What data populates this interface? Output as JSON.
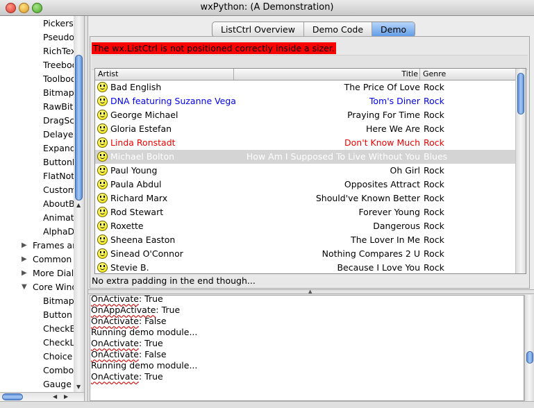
{
  "window": {
    "title": "wxPython: (A Demonstration)"
  },
  "tree": {
    "items": [
      {
        "label": "Pickers",
        "level": 2
      },
      {
        "label": "PseudoDC",
        "level": 2
      },
      {
        "label": "RichTextCtrl",
        "level": 2
      },
      {
        "label": "Treebook",
        "level": 2
      },
      {
        "label": "Toolbook",
        "level": 2
      },
      {
        "label": "BitmapButton",
        "level": 2
      },
      {
        "label": "RawBitmapAccess",
        "level": 2
      },
      {
        "label": "DragScroller",
        "level": 2
      },
      {
        "label": "DelayedResult",
        "level": 2
      },
      {
        "label": "ExpandoTextCtrl",
        "level": 2
      },
      {
        "label": "ButtonPanel",
        "level": 2
      },
      {
        "label": "FlatNotebook",
        "level": 2
      },
      {
        "label": "CustomTreeCtrl",
        "level": 2
      },
      {
        "label": "AboutBox",
        "level": 2
      },
      {
        "label": "AnimateCtrl",
        "level": 2
      },
      {
        "label": "AlphaDrawing",
        "level": 2
      },
      {
        "label": "Frames and Dialogs",
        "level": 1,
        "expanded": false
      },
      {
        "label": "Common Dialogs",
        "level": 1,
        "expanded": false
      },
      {
        "label": "More Dialogs",
        "level": 1,
        "expanded": false
      },
      {
        "label": "Core Windows/Controls",
        "level": 1,
        "expanded": true
      },
      {
        "label": "BitmapButton",
        "level": 2
      },
      {
        "label": "Button",
        "level": 2
      },
      {
        "label": "CheckBox",
        "level": 2
      },
      {
        "label": "CheckListBox",
        "level": 2
      },
      {
        "label": "Choice",
        "level": 2
      },
      {
        "label": "ComboBox",
        "level": 2
      },
      {
        "label": "Gauge",
        "level": 2
      }
    ]
  },
  "tabs": [
    {
      "label": "ListCtrl Overview",
      "selected": false
    },
    {
      "label": "Demo Code",
      "selected": false
    },
    {
      "label": "Demo",
      "selected": true
    }
  ],
  "demo": {
    "warning": "The wx.ListCtrl is not positioned correctly inside a sizer.",
    "columns": {
      "artist": "Artist",
      "title": "Title",
      "genre": "Genre"
    },
    "rows": [
      {
        "artist": "Bad English",
        "title": "The Price Of Love",
        "genre": "Rock",
        "color": "#000000",
        "selected": false
      },
      {
        "artist": "DNA featuring Suzanne Vega",
        "title": "Tom's Diner",
        "genre": "Rock",
        "color": "#0000ee",
        "selected": false
      },
      {
        "artist": "George Michael",
        "title": "Praying For Time",
        "genre": "Rock",
        "color": "#000000",
        "selected": false
      },
      {
        "artist": "Gloria Estefan",
        "title": "Here We Are",
        "genre": "Rock",
        "color": "#000000",
        "selected": false
      },
      {
        "artist": "Linda Ronstadt",
        "title": "Don't Know Much",
        "genre": "Rock",
        "color": "#ee0000",
        "selected": false
      },
      {
        "artist": "Michael Bolton",
        "title": "How Am I Supposed To Live Without You",
        "genre": "Blues",
        "color": "#ffffff",
        "selected": true
      },
      {
        "artist": "Paul Young",
        "title": "Oh Girl",
        "genre": "Rock",
        "color": "#000000",
        "selected": false
      },
      {
        "artist": "Paula Abdul",
        "title": "Opposites Attract",
        "genre": "Rock",
        "color": "#000000",
        "selected": false
      },
      {
        "artist": "Richard Marx",
        "title": "Should've Known Better",
        "genre": "Rock",
        "color": "#000000",
        "selected": false
      },
      {
        "artist": "Rod Stewart",
        "title": "Forever Young",
        "genre": "Rock",
        "color": "#000000",
        "selected": false
      },
      {
        "artist": "Roxette",
        "title": "Dangerous",
        "genre": "Rock",
        "color": "#000000",
        "selected": false
      },
      {
        "artist": "Sheena Easton",
        "title": "The Lover In Me",
        "genre": "Rock",
        "color": "#000000",
        "selected": false
      },
      {
        "artist": "Sinead O'Connor",
        "title": "Nothing Compares 2 U",
        "genre": "Rock",
        "color": "#000000",
        "selected": false
      },
      {
        "artist": "Stevie B.",
        "title": "Because I Love You",
        "genre": "Rock",
        "color": "#000000",
        "selected": false
      }
    ],
    "footer": "No extra padding in the end though..."
  },
  "log": {
    "lines": [
      {
        "word": "OnActivate",
        "rest": ": True"
      },
      {
        "word": "OnAppActivate",
        "rest": ": True"
      },
      {
        "word": "OnActivate",
        "rest": ": False"
      },
      {
        "word": "",
        "rest": "Running demo module..."
      },
      {
        "word": "OnActivate",
        "rest": ": True"
      },
      {
        "word": "OnActivate",
        "rest": ": False"
      },
      {
        "word": "",
        "rest": "Running demo module..."
      },
      {
        "word": "OnActivate",
        "rest": ": True"
      }
    ]
  },
  "colors": {
    "warning_bg": "#ff0000",
    "selection": "#d4d4d4",
    "accent": "#5f9ae6"
  }
}
